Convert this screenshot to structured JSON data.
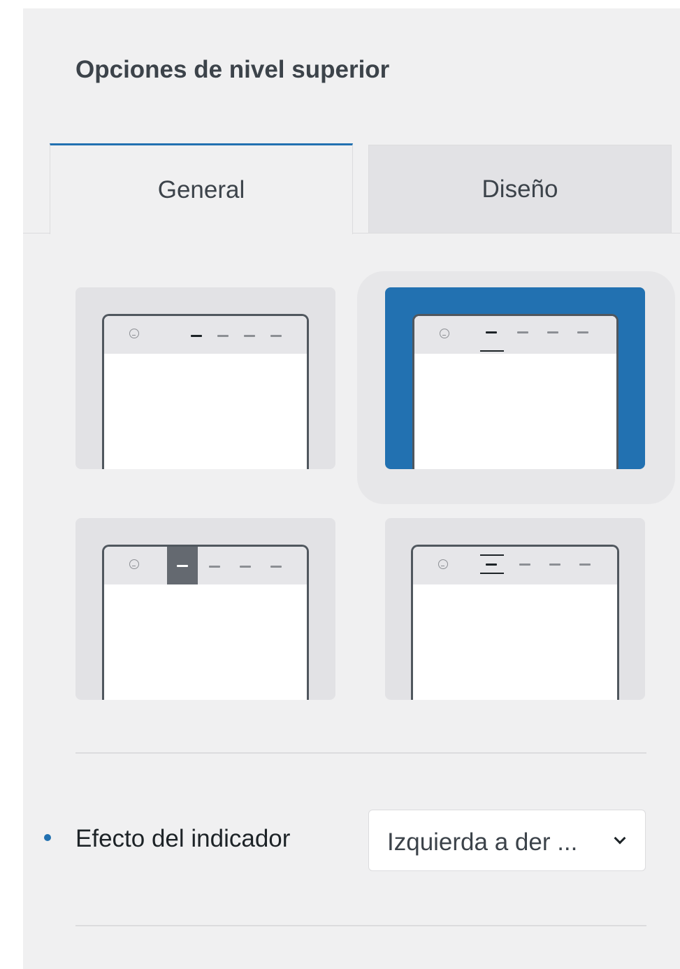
{
  "section": {
    "title": "Opciones de nivel superior"
  },
  "tabs": [
    {
      "label": "General",
      "active": true
    },
    {
      "label": "Diseño",
      "active": false
    }
  ],
  "style_options": [
    {
      "name": "indicator-underline-dark",
      "selected": false
    },
    {
      "name": "indicator-line-below",
      "selected": true
    },
    {
      "name": "indicator-filled-block",
      "selected": false
    },
    {
      "name": "indicator-overline-underline",
      "selected": false
    }
  ],
  "controls": {
    "indicator_effect": {
      "label": "Efecto del indicador",
      "value": "Izquierda a der ...",
      "modified_marker": true
    }
  },
  "colors": {
    "accent": "#2271b1",
    "panel_bg": "#f0f0f1",
    "option_bg": "#e2e2e5",
    "text": "#1d2327"
  },
  "icons": {
    "logo": "wordpress-icon",
    "select_arrow": "chevron-down-icon"
  }
}
